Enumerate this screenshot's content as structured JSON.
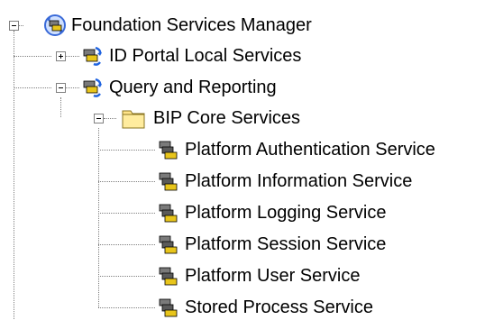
{
  "tree": {
    "nodes": [
      {
        "label": "Foundation Services Manager",
        "icon": "services-manager-icon",
        "expander": "minus"
      },
      {
        "label": "ID Portal Local Services",
        "icon": "services-group-icon",
        "expander": "plus"
      },
      {
        "label": "Query and Reporting",
        "icon": "services-group-icon",
        "expander": "minus"
      },
      {
        "label": "BIP Core Services",
        "icon": "folder-icon",
        "expander": "minus"
      },
      {
        "label": "Platform Authentication Service",
        "icon": "service-icon"
      },
      {
        "label": "Platform Information Service",
        "icon": "service-icon"
      },
      {
        "label": "Platform Logging Service",
        "icon": "service-icon"
      },
      {
        "label": "Platform Session Service",
        "icon": "service-icon"
      },
      {
        "label": "Platform User Service",
        "icon": "service-icon"
      },
      {
        "label": "Stored Process Service",
        "icon": "service-icon"
      }
    ]
  }
}
